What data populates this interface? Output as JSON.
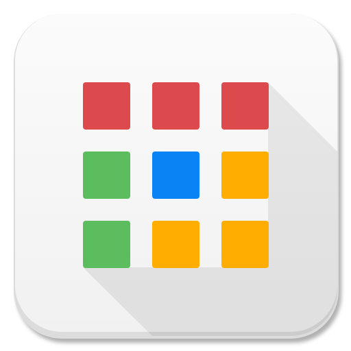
{
  "app_icon": {
    "icon_name": "app-launcher-grid-icon",
    "tile_background": "#f6f6f6",
    "tile_border": "#e6e6e6",
    "long_shadow_color": "#000000",
    "grid": {
      "rows": 3,
      "cols": 3,
      "cells": [
        {
          "name": "tile-red-1",
          "color": "#dc4a4d"
        },
        {
          "name": "tile-red-2",
          "color": "#dc4a4d"
        },
        {
          "name": "tile-red-3",
          "color": "#dc4a4d"
        },
        {
          "name": "tile-green-1",
          "color": "#5cbd5f"
        },
        {
          "name": "tile-blue-1",
          "color": "#0a84f5"
        },
        {
          "name": "tile-orange-1",
          "color": "#ffae00"
        },
        {
          "name": "tile-green-2",
          "color": "#5cbd5f"
        },
        {
          "name": "tile-orange-2",
          "color": "#ffae00"
        },
        {
          "name": "tile-orange-3",
          "color": "#ffae00"
        }
      ]
    }
  }
}
